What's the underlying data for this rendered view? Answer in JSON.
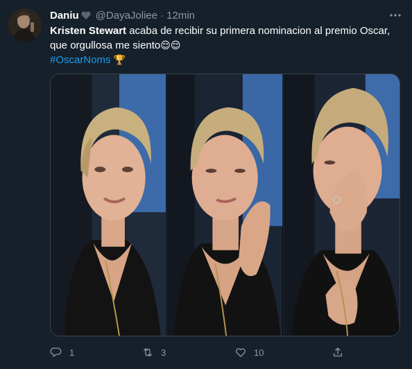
{
  "tweet": {
    "author": {
      "display_name": "Daniu",
      "badge_icon": "black-heart-icon",
      "handle": "@DayaJoliee",
      "separator": "·",
      "time": "12min"
    },
    "text": {
      "bold_part": "Kristen Stewart",
      "rest_line1": " acaba de recibir su primera nominacion al premio Oscar,",
      "line2": "que orgullosa me siento",
      "emojis": "😌😌",
      "hashtag": "#OscarNoms",
      "hashtag_emoji": "🏆"
    },
    "media": {
      "panels": 3
    },
    "actions": {
      "reply_count": "1",
      "retweet_count": "3",
      "like_count": "10"
    }
  },
  "colors": {
    "background": "#15202b",
    "link": "#1d9bf0",
    "secondary_text": "#8b98a5",
    "border": "#38444d"
  }
}
